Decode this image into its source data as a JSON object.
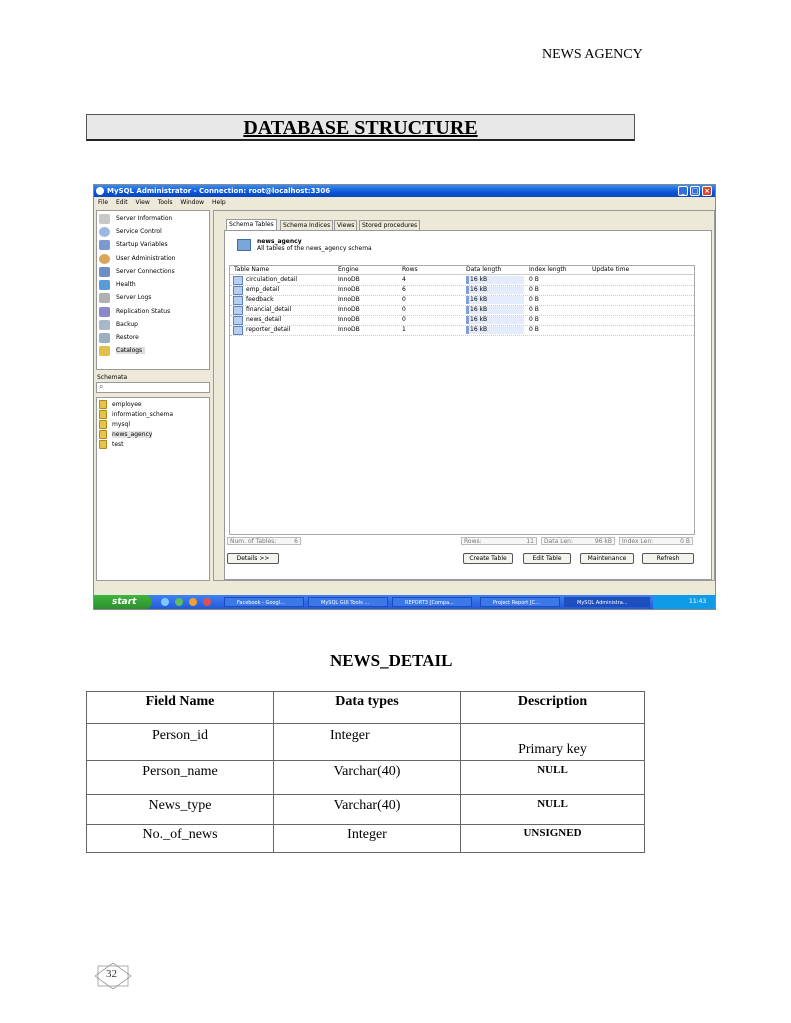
{
  "header_right": "NEWS AGENCY",
  "section_title": "DATABASE STRUCTURE",
  "screenshot": {
    "window_title": "MySQL Administrator - Connection: root@localhost:3306",
    "menu": [
      "File",
      "Edit",
      "View",
      "Tools",
      "Window",
      "Help"
    ],
    "nav_items": [
      "Server Information",
      "Service Control",
      "Startup Variables",
      "User Administration",
      "Server Connections",
      "Health",
      "Server Logs",
      "Replication Status",
      "Backup",
      "Restore",
      "Catalogs"
    ],
    "schemata_label": "Schemata",
    "schemas": [
      "employee",
      "information_schema",
      "mysql",
      "news_agency",
      "test"
    ],
    "tabs": [
      "Schema Tables",
      "Schema Indices",
      "Views",
      "Stored procedures"
    ],
    "schema_name": "news_agency",
    "schema_desc": "All tables of the news_agency schema",
    "columns": [
      "Table Name",
      "Engine",
      "Rows",
      "Data length",
      "Index length",
      "Update time"
    ],
    "rows": [
      {
        "name": "circulation_detail",
        "engine": "InnoDB",
        "rows": "4",
        "data": "16 kB",
        "index": "0 B"
      },
      {
        "name": "emp_detail",
        "engine": "InnoDB",
        "rows": "6",
        "data": "16 kB",
        "index": "0 B"
      },
      {
        "name": "feedback",
        "engine": "InnoDB",
        "rows": "0",
        "data": "16 kB",
        "index": "0 B"
      },
      {
        "name": "financial_detail",
        "engine": "InnoDB",
        "rows": "0",
        "data": "16 kB",
        "index": "0 B"
      },
      {
        "name": "news_detail",
        "engine": "InnoDB",
        "rows": "0",
        "data": "16 kB",
        "index": "0 B"
      },
      {
        "name": "reporter_detail",
        "engine": "InnoDB",
        "rows": "1",
        "data": "16 kB",
        "index": "0 B"
      }
    ],
    "status": {
      "num_tables_label": "Num. of Tables:",
      "num_tables": "6",
      "rows_label": "Rows:",
      "rows": "11",
      "data_len_label": "Data Len:",
      "data_len": "96 kB",
      "index_len_label": "Index Len:",
      "index_len": "0 B"
    },
    "buttons": {
      "details": "Details >>",
      "create": "Create Table",
      "edit": "Edit Table",
      "maintenance": "Maintenance",
      "refresh": "Refresh"
    },
    "taskbar": {
      "start": "start",
      "items": [
        "Facebook - Googl...",
        "MySQL GUI Tools ...",
        "REPORT3 [Compa...",
        "Project Report [C...",
        "MySQL Administra..."
      ],
      "clock": "11:43 AM"
    }
  },
  "table_title": "NEWS_DETAIL",
  "table_headers": [
    "Field Name",
    "Data types",
    "Description"
  ],
  "table_rows": [
    {
      "field": "Person_id",
      "type": "Integer",
      "desc": "Primary key"
    },
    {
      "field": "Person_name",
      "type": "Varchar(40)",
      "desc": "NULL"
    },
    {
      "field": "News_type",
      "type": "Varchar(40)",
      "desc": "NULL"
    },
    {
      "field": "No._of_news",
      "type": "Integer",
      "desc": "UNSIGNED"
    }
  ],
  "page_number": "32"
}
